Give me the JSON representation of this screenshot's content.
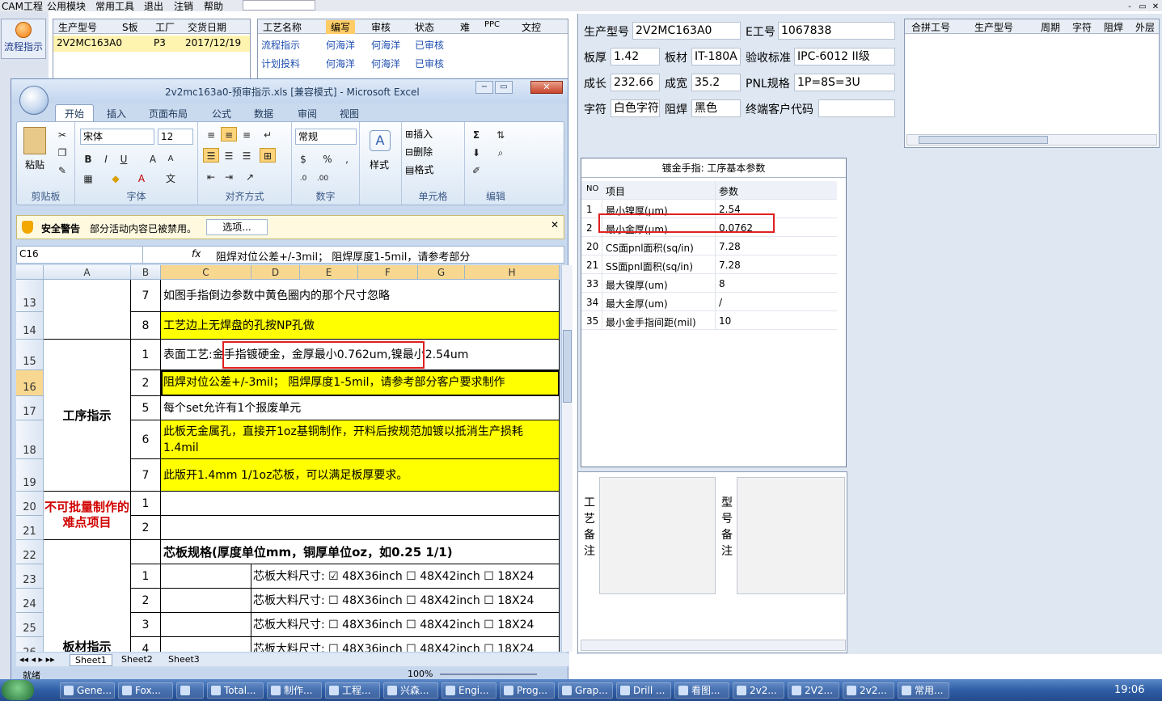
{
  "app": {
    "menu": [
      "CAM工程",
      "公用模块",
      "常用工具",
      "退出",
      "注销",
      "帮助"
    ],
    "flow_button": "流程指示",
    "window_controls": [
      "-",
      "▭",
      "✕"
    ]
  },
  "left_grid": {
    "headers": [
      "生产型号",
      "S板",
      "工厂",
      "交货日期"
    ],
    "row": [
      "2V2MC163A0",
      "",
      "P3",
      "2017/12/19"
    ]
  },
  "process_grid": {
    "headers": [
      "工艺名称",
      "编写",
      "审核",
      "状态",
      "难",
      "PPC",
      "文控"
    ],
    "rows": [
      [
        "流程指示",
        "何海洋",
        "何海洋",
        "已审核"
      ],
      [
        "计划投料",
        "何海洋",
        "何海洋",
        "已审核"
      ]
    ]
  },
  "excel": {
    "title": "2v2mc163a0-预审指示.xls  [兼容模式] - Microsoft Excel",
    "tabs": [
      "开始",
      "插入",
      "页面布局",
      "公式",
      "数据",
      "审阅",
      "视图"
    ],
    "ribbon": {
      "paste": "粘贴",
      "clipboard": "剪贴板",
      "font_name": "宋体",
      "font_size": "12",
      "font_group": "字体",
      "align_group": "对齐方式",
      "number_format": "常规",
      "number_group": "数字",
      "style": "样式",
      "insert": "插入",
      "delete": "删除",
      "format": "格式",
      "cells_group": "单元格",
      "edit_group": "编辑"
    },
    "security": {
      "title": "安全警告",
      "message": "部分活动内容已被禁用。",
      "options_button": "选项..."
    },
    "name_box": "C16",
    "formula": "阻焊对位公差+/-3mil；   阻焊厚度1-5mil，请参考部分",
    "columns": [
      "A",
      "B",
      "C",
      "D",
      "E",
      "F",
      "G",
      "H"
    ],
    "rows": [
      {
        "row": "13",
        "b": "7",
        "c": "如图手指倒边参数中黄色圈内的那个尺寸忽略",
        "yellow": false
      },
      {
        "row": "14",
        "b": "8",
        "c": "工艺边上无焊盘的孔按NP孔做",
        "yellow": true
      },
      {
        "row": "15",
        "b": "1",
        "c": "表面工艺:金手指镀硬金，金厚最小0.762um,镍最小2.54um",
        "yellow": false
      },
      {
        "row": "16",
        "b": "2",
        "c": "阻焊对位公差+/-3mil；   阻焊厚度1-5mil，请参考部分客户要求制作",
        "yellow": true
      },
      {
        "row": "17",
        "b": "5",
        "c": "每个set允许有1个报废单元",
        "yellow": false
      },
      {
        "row": "18",
        "b": "6",
        "c": "此板无金属孔，直接开1oz基铜制作，开料后按规范加镀以抵消生产损耗",
        "c2": "1.4mil",
        "yellow": true
      },
      {
        "row": "19",
        "b": "7",
        "c": "此版开1.4mm 1/1oz芯板，可以满足板厚要求。",
        "yellow": true
      },
      {
        "row": "20",
        "b": "1",
        "c": "",
        "yellow": false
      },
      {
        "row": "21",
        "b": "2",
        "c": "",
        "yellow": false
      },
      {
        "row": "22",
        "b": "",
        "c": "芯板规格(厚度单位mm，铜厚单位oz，如0.25 1/1)",
        "yellow": false
      },
      {
        "row": "23",
        "b": "1",
        "c": "",
        "yellow": false
      },
      {
        "row": "24",
        "b": "2",
        "c": "",
        "yellow": false
      },
      {
        "row": "25",
        "b": "3",
        "c": "",
        "yellow": false
      },
      {
        "row": "26",
        "b": "4",
        "c": "",
        "yellow": false
      }
    ],
    "merged_a": {
      "process": "工序指示",
      "difficulty": "不可批量制作的难点项目",
      "material": "板材指示"
    },
    "core_label": "芯板大料尺寸:",
    "core_options": [
      "48X36inch",
      "48X42inch",
      "18X24"
    ],
    "sheets": [
      "Sheet1",
      "Sheet2",
      "Sheet3"
    ],
    "status": "就绪",
    "zoom": "100%"
  },
  "info": {
    "model_label": "生产型号",
    "model": "2V2MC163A0",
    "eno_label": "E工号",
    "eno": "1067838",
    "thick_label": "板厚",
    "thick": "1.42",
    "mat_label": "板材",
    "mat": "IT-180A",
    "std_label": "验收标准",
    "std": "IPC-6012 II级",
    "len_label": "成长",
    "len": "232.66",
    "wid_label": "成宽",
    "wid": "35.2",
    "pnl_label": "PNL规格",
    "pnl": "1P=8S=3U",
    "char_label": "字符",
    "char": "白色字符",
    "mask_label": "阻焊",
    "mask": "黑色",
    "cust_label": "终端客户代码",
    "cust": ""
  },
  "merge_grid": {
    "headers": [
      "合拼工号",
      "生产型号",
      "周期",
      "字符",
      "阻焊",
      "外层"
    ]
  },
  "params": {
    "title": "镀金手指: 工序基本参数",
    "headers": [
      "NO",
      "项目",
      "参数"
    ],
    "rows": [
      [
        "1",
        "最小镍厚(μm)",
        "2.54"
      ],
      [
        "2",
        "最小金厚(μm)",
        "0.0762"
      ],
      [
        "20",
        "CS面pnl面积(sq/in)",
        "7.28"
      ],
      [
        "21",
        "SS面pnl面积(sq/in)",
        "7.28"
      ],
      [
        "33",
        "最大镍厚(um)",
        "8"
      ],
      [
        "34",
        "最大金厚(um)",
        "/"
      ],
      [
        "35",
        "最小金手指间距(mil)",
        "10"
      ]
    ]
  },
  "notes": {
    "process_note": "工艺备注",
    "model_note": "型号备注"
  },
  "taskbar": {
    "items": [
      "Gene...",
      "Fox...",
      "",
      "Total...",
      "制作...",
      "工程...",
      "兴森...",
      "Engi...",
      "Prog...",
      "Grap...",
      "Drill ...",
      "看图...",
      "2v2...",
      "2V2...",
      "2v2...",
      "常用..."
    ],
    "time": "19:06"
  }
}
